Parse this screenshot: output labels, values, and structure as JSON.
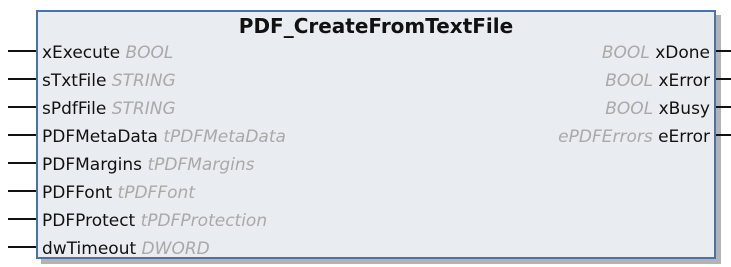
{
  "function_block": {
    "title": "PDF_CreateFromTextFile",
    "inputs": [
      {
        "name": "xExecute",
        "type": "BOOL"
      },
      {
        "name": "sTxtFile",
        "type": "STRING"
      },
      {
        "name": "sPdfFile",
        "type": "STRING"
      },
      {
        "name": "PDFMetaData",
        "type": "tPDFMetaData"
      },
      {
        "name": "PDFMargins",
        "type": "tPDFMargins"
      },
      {
        "name": "PDFFont",
        "type": "tPDFFont"
      },
      {
        "name": "PDFProtect",
        "type": "tPDFProtection"
      },
      {
        "name": "dwTimeout",
        "type": "DWORD"
      }
    ],
    "outputs": [
      {
        "name": "xDone",
        "type": "BOOL"
      },
      {
        "name": "xError",
        "type": "BOOL"
      },
      {
        "name": "xBusy",
        "type": "BOOL"
      },
      {
        "name": "eError",
        "type": "ePDFErrors"
      }
    ]
  }
}
